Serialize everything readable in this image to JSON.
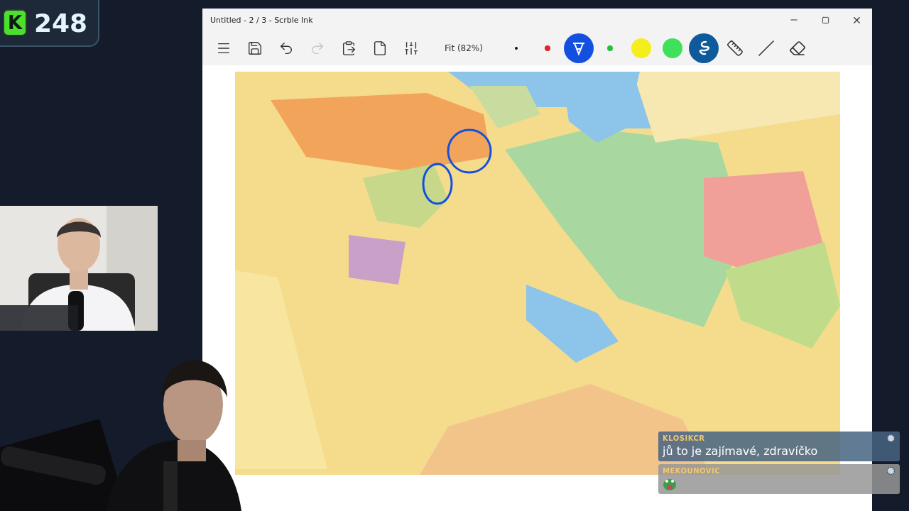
{
  "score_badge": {
    "letter": "K",
    "count": "248"
  },
  "window": {
    "title": "Untitled - 2 / 3 - Scrble Ink",
    "toolbar": {
      "buttons": [
        {
          "kind": "menu",
          "disabled": false
        },
        {
          "kind": "save",
          "disabled": false
        },
        {
          "kind": "undo",
          "disabled": false
        },
        {
          "kind": "redo",
          "disabled": true
        },
        {
          "kind": "paste",
          "disabled": false
        },
        {
          "kind": "page",
          "disabled": false
        },
        {
          "kind": "settings",
          "disabled": false
        }
      ],
      "zoom": "Fit (82%)",
      "pens": [
        {
          "kind": "dot",
          "color": "#111111",
          "selected": false
        },
        {
          "kind": "dot",
          "color": "#e02424",
          "selected": false
        },
        {
          "kind": "pen",
          "color": "#1450e0",
          "selected": true
        },
        {
          "kind": "dot",
          "color": "#22c23a",
          "selected": false
        },
        {
          "kind": "swatch",
          "color": "#f4ee1c",
          "selected": false
        },
        {
          "kind": "swatch",
          "color": "#3fe05c",
          "selected": false
        },
        {
          "kind": "highlighter",
          "color": "#0e5a9a",
          "selected": true
        }
      ],
      "tools": [
        {
          "kind": "ruler"
        },
        {
          "kind": "line"
        },
        {
          "kind": "eraser"
        }
      ]
    }
  },
  "chat": [
    {
      "kind": "text",
      "user": "KLOSIKCR",
      "text": "jů to je zajímavé, zdravíčko"
    },
    {
      "kind": "emote",
      "user": "MEKOUNOVIC"
    }
  ]
}
